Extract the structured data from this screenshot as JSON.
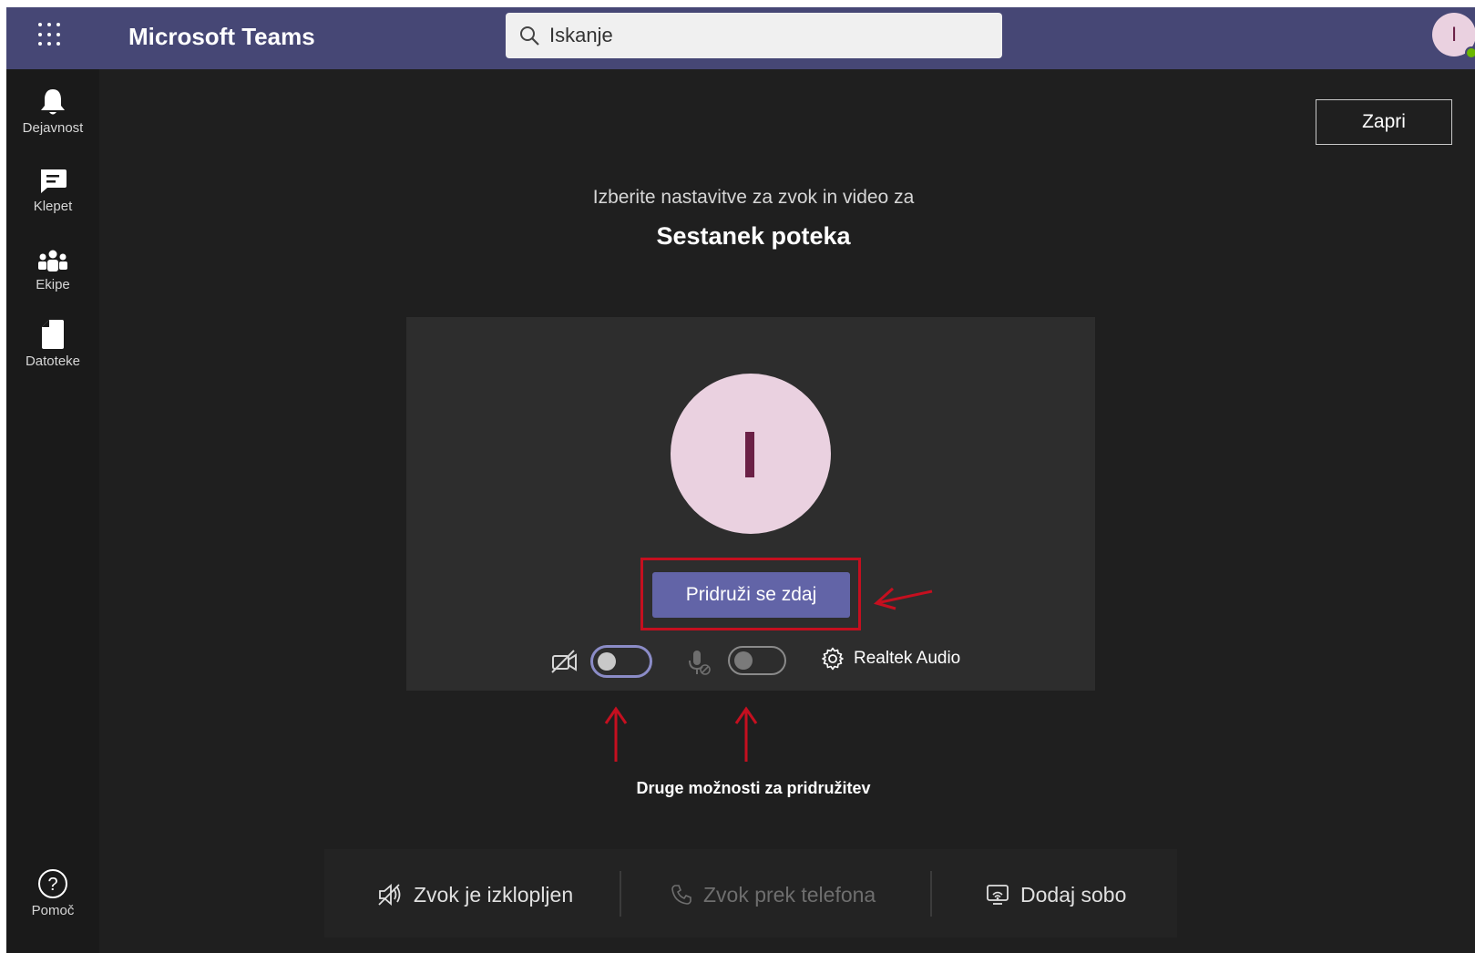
{
  "header": {
    "app_title": "Microsoft Teams",
    "search_placeholder": "Iskanje",
    "avatar_initial": "I"
  },
  "sidebar": {
    "items": [
      {
        "label": "Dejavnost",
        "icon": "bell-icon"
      },
      {
        "label": "Klepet",
        "icon": "chat-icon"
      },
      {
        "label": "Ekipe",
        "icon": "teams-icon"
      },
      {
        "label": "Datoteke",
        "icon": "file-icon"
      }
    ],
    "help": {
      "label": "Pomoč",
      "icon": "help-icon"
    }
  },
  "main": {
    "close_label": "Zapri",
    "subtitle": "Izberite nastavitve za zvok in video za",
    "meeting_title": "Sestanek poteka",
    "preview": {
      "avatar_initial": "I",
      "join_label": "Pridruži se zdaj",
      "camera_on": false,
      "mic_on": false,
      "device_label": "Realtek Audio"
    },
    "other_options_title": "Druge možnosti za pridružitev",
    "options": [
      {
        "label": "Zvok je izklopljen",
        "icon": "speaker-off-icon",
        "enabled": true
      },
      {
        "label": "Zvok prek telefona",
        "icon": "phone-icon",
        "enabled": false
      },
      {
        "label": "Dodaj sobo",
        "icon": "cast-room-icon",
        "enabled": true
      }
    ]
  },
  "colors": {
    "topbar": "#464775",
    "background": "#1f1f1f",
    "accent": "#6264a7",
    "annotation": "#c50f1f"
  }
}
